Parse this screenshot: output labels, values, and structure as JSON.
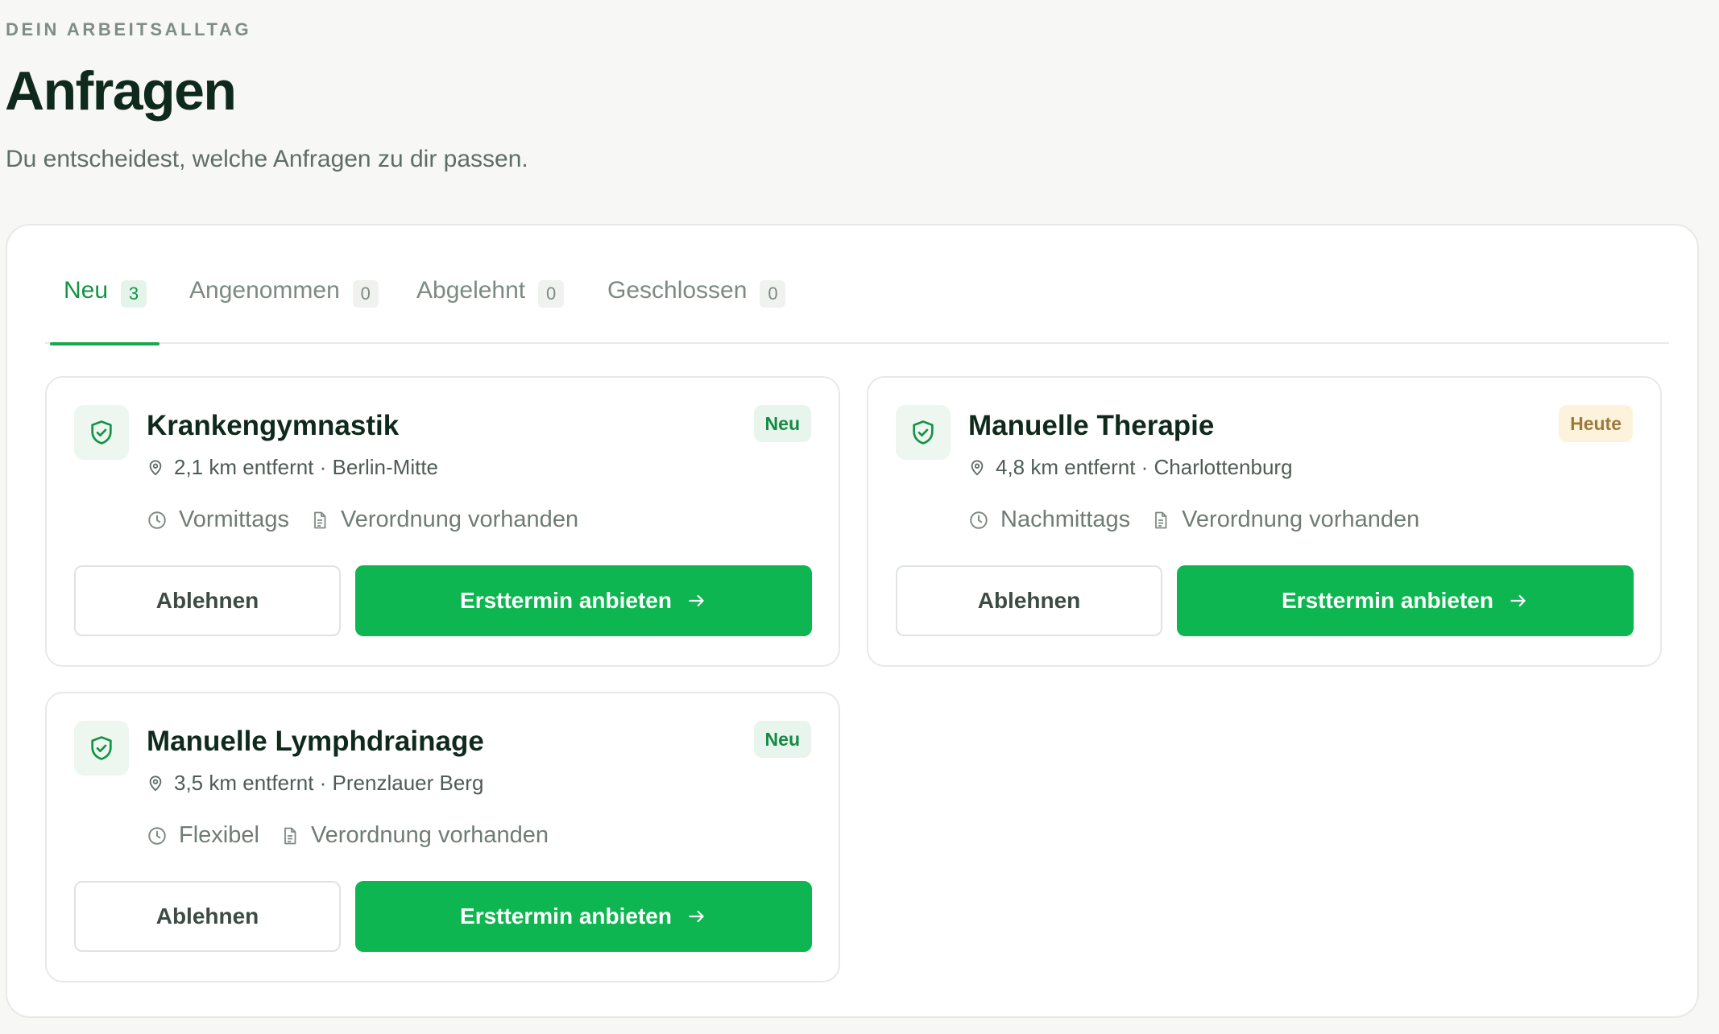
{
  "header": {
    "eyebrow": "DEIN ARBEITSALLTAG",
    "title": "Anfragen",
    "subtitle": "Du entscheidest, welche Anfragen zu dir passen."
  },
  "tabs": [
    {
      "label": "Neu",
      "count": "3",
      "active": true
    },
    {
      "label": "Angenommen",
      "count": "0",
      "active": false
    },
    {
      "label": "Abgelehnt",
      "count": "0",
      "active": false
    },
    {
      "label": "Geschlossen",
      "count": "0",
      "active": false
    }
  ],
  "colors": {
    "accent": "#0db650",
    "accent_text": "#149447",
    "badge_new_bg": "#e8f5ec",
    "badge_today_bg": "#fdf3dd"
  },
  "requests": [
    {
      "name": "Krankengymnastik",
      "badge": "Neu",
      "badge_style": "green",
      "distance": "2,1 km entfernt",
      "area": "Berlin-Mitte",
      "time": "Vormittags",
      "prescription": "Verordnung vorhanden",
      "decline_label": "Ablehnen",
      "accept_label": "Ersttermin anbieten"
    },
    {
      "name": "Manuelle Therapie",
      "badge": "Heute",
      "badge_style": "amber",
      "distance": "4,8 km entfernt",
      "area": "Charlottenburg",
      "time": "Nachmittags",
      "prescription": "Verordnung vorhanden",
      "decline_label": "Ablehnen",
      "accept_label": "Ersttermin anbieten"
    },
    {
      "name": "Manuelle Lymphdrainage",
      "badge": "Neu",
      "badge_style": "green",
      "distance": "3,5 km entfernt",
      "area": "Prenzlauer Berg",
      "time": "Flexibel",
      "prescription": "Verordnung vorhanden",
      "decline_label": "Ablehnen",
      "accept_label": "Ersttermin anbieten"
    }
  ],
  "icons": {
    "card": "shield-check-icon",
    "location": "map-pin-icon",
    "time": "clock-icon",
    "document": "document-icon",
    "arrow": "arrow-right-icon"
  }
}
